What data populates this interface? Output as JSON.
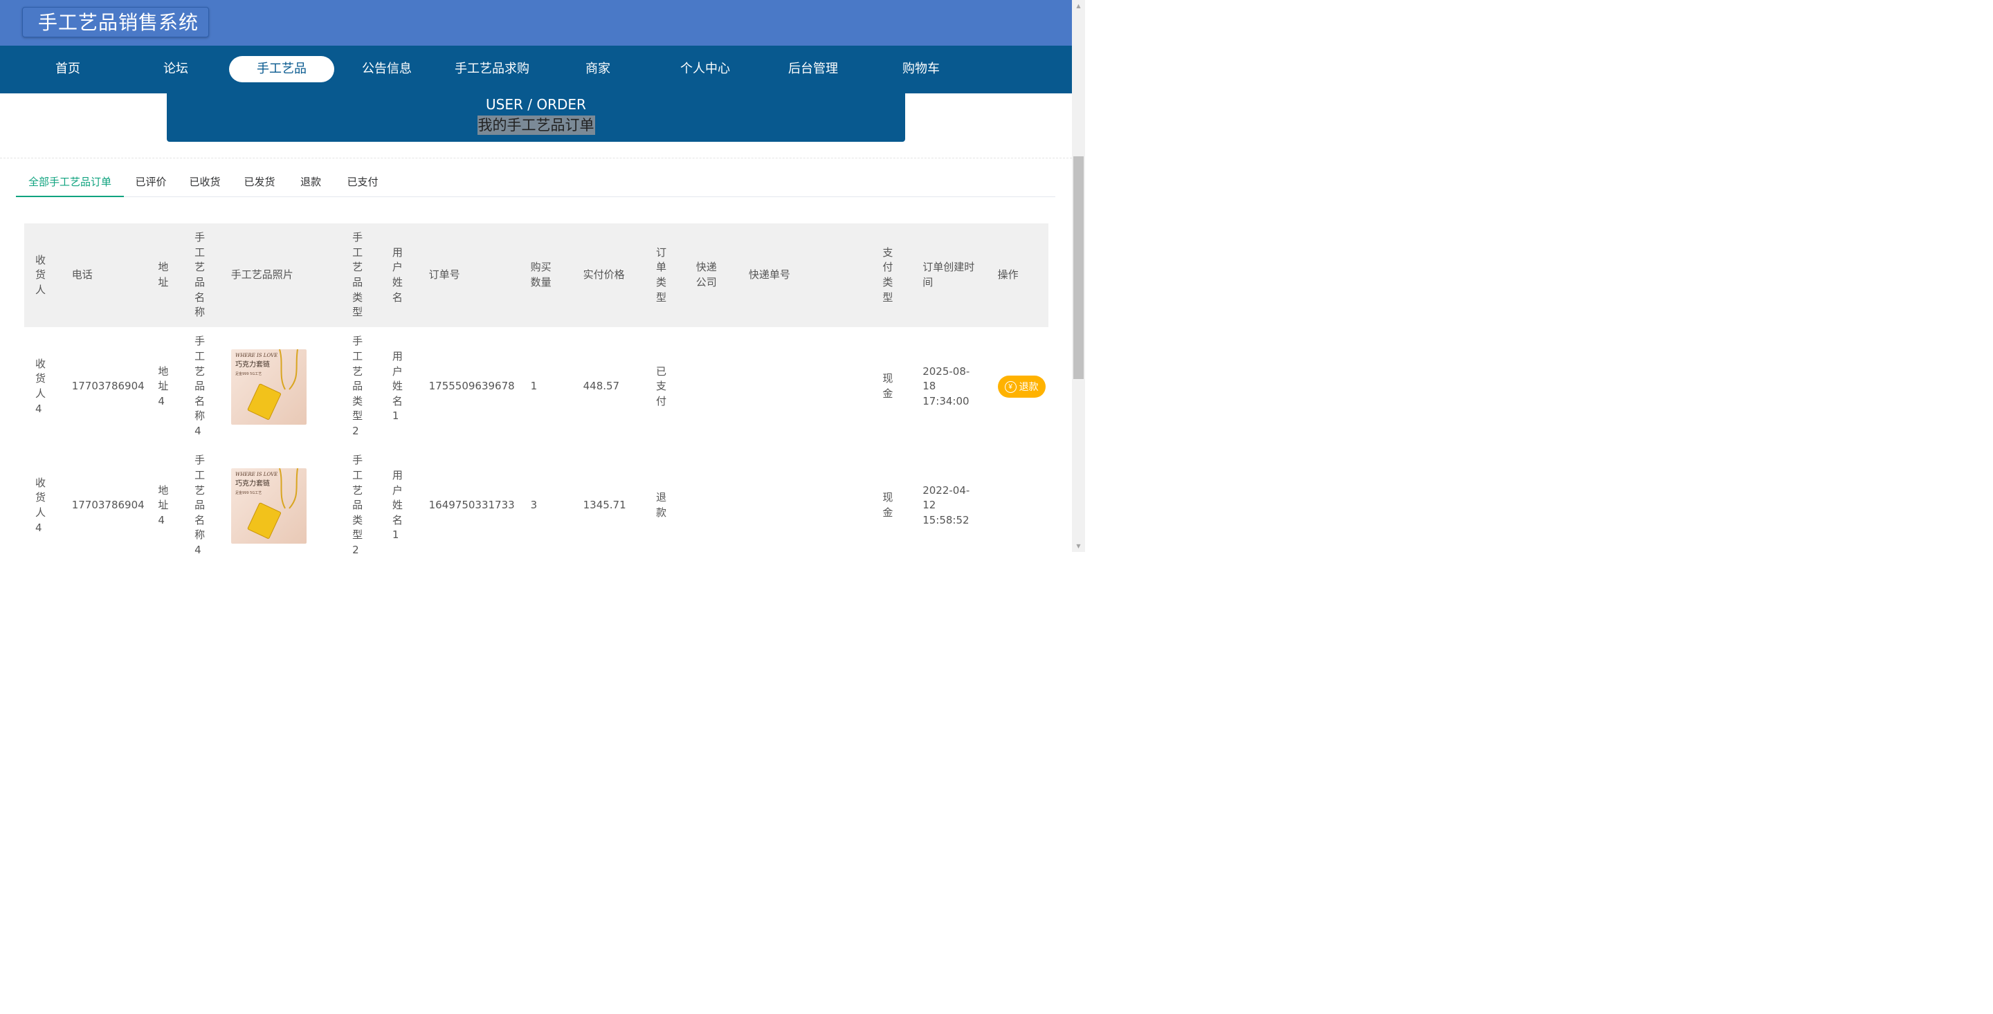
{
  "app_title": "手工艺品销售系统",
  "nav": [
    {
      "label": "首页"
    },
    {
      "label": "论坛"
    },
    {
      "label": "手工艺品",
      "active": true
    },
    {
      "label": "公告信息"
    },
    {
      "label": "手工艺品求购"
    },
    {
      "label": "商家"
    },
    {
      "label": "个人中心"
    },
    {
      "label": "后台管理"
    },
    {
      "label": "购物车"
    }
  ],
  "hero": {
    "title_en": "USER / ORDER",
    "title_cn": "我的手工艺品订单"
  },
  "tabs": [
    {
      "label": "全部手工艺品订单",
      "active": true
    },
    {
      "label": "已评价"
    },
    {
      "label": "已收货"
    },
    {
      "label": "已发货"
    },
    {
      "label": "退款"
    },
    {
      "label": "已支付"
    }
  ],
  "table": {
    "headers": {
      "receiver": "收货人",
      "phone": "电话",
      "address": "地址",
      "craft_name": "手工艺品名称",
      "craft_photo": "手工艺品照片",
      "craft_type": "手工艺品类型",
      "user_name": "用户姓名",
      "order_no": "订单号",
      "quantity": "购买数量",
      "price": "实付价格",
      "order_type": "订单类型",
      "express_company": "快递公司",
      "express_no": "快递单号",
      "pay_type": "支付类型",
      "created_at": "订单创建时间",
      "action": "操作"
    },
    "rows": [
      {
        "receiver": "收货人4",
        "phone": "17703786904",
        "address": "地址4",
        "craft_name": "手工艺品名称4",
        "photo_line1": "WHERE IS LOVE",
        "photo_line2": "巧克力套链",
        "photo_line3": "足金999   5G工艺",
        "craft_type": "手工艺品类型2",
        "user_name": "用户姓名1",
        "order_no": "1755509639678",
        "quantity": "1",
        "price": "448.57",
        "order_type": "已支付",
        "express_company": "",
        "express_no": "",
        "pay_type": "现金",
        "created_at": "2025-08-18 17:34:00",
        "action_label": "退款",
        "action_icon": "yen-icon"
      },
      {
        "receiver": "收货人4",
        "phone": "17703786904",
        "address": "地址4",
        "craft_name": "手工艺品名称4",
        "photo_line1": "WHERE IS LOVE",
        "photo_line2": "巧克力套链",
        "photo_line3": "足金999   5G工艺",
        "craft_type": "手工艺品类型2",
        "user_name": "用户姓名1",
        "order_no": "1649750331733",
        "quantity": "3",
        "price": "1345.71",
        "order_type": "退款",
        "express_company": "",
        "express_no": "",
        "pay_type": "现金",
        "created_at": "2022-04-12 15:58:52",
        "action_label": "",
        "action_icon": ""
      }
    ]
  },
  "colors": {
    "topbar": "#4a79c7",
    "navbar": "#08598f",
    "tab_active": "#10a37f",
    "refund_button": "#ffb200"
  }
}
